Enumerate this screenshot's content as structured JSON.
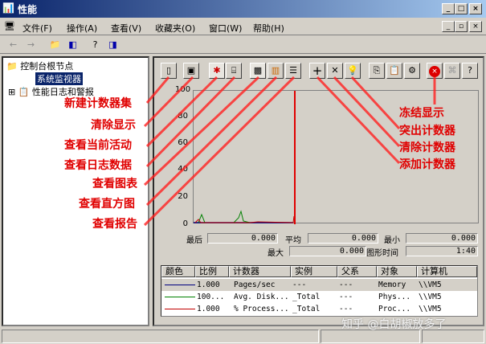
{
  "window": {
    "title": "性能"
  },
  "menu": [
    "文件(F)",
    "操作(A)",
    "查看(V)",
    "收藏夹(O)",
    "窗口(W)",
    "帮助(H)"
  ],
  "tree": {
    "root": "控制台根节点",
    "items": [
      "系统监视器",
      "性能日志和警报"
    ]
  },
  "graph": {
    "y_ticks": [
      "100",
      "80",
      "60",
      "40",
      "20",
      "0"
    ]
  },
  "stats": {
    "last_label": "最后",
    "last": "0.000",
    "avg_label": "平均",
    "avg": "0.000",
    "min_label": "最小",
    "min": "0.000",
    "max_label": "最大",
    "max": "0.000",
    "duration_label": "图形时间",
    "duration": "1:40"
  },
  "legend": {
    "headers": [
      "颜色",
      "比例",
      "计数器",
      "实例",
      "父系",
      "对象",
      "计算机"
    ],
    "rows": [
      {
        "color": "#000080",
        "scale": "1.000",
        "counter": "Pages/sec",
        "instance": "---",
        "parent": "---",
        "object": "Memory",
        "computer": "\\\\VM5"
      },
      {
        "color": "#008000",
        "scale": "100...",
        "counter": "Avg. Disk...",
        "instance": "_Total",
        "parent": "---",
        "object": "Phys...",
        "computer": "\\\\VM5"
      },
      {
        "color": "#c00000",
        "scale": "1.000",
        "counter": "% Process...",
        "instance": "_Total",
        "parent": "---",
        "object": "Proc...",
        "computer": "\\\\VM5"
      }
    ]
  },
  "annotations": {
    "left": [
      "新建计数器集",
      "清除显示",
      "查看当前活动",
      "查看日志数据",
      "查看图表",
      "查看直方图",
      "查看报告"
    ],
    "right": [
      "冻结显示",
      "突出计数器",
      "清除计数器",
      "添加计数器"
    ]
  },
  "watermark": "知乎 @白胡椒放多了",
  "colors": {
    "annotation": "#e00000"
  }
}
